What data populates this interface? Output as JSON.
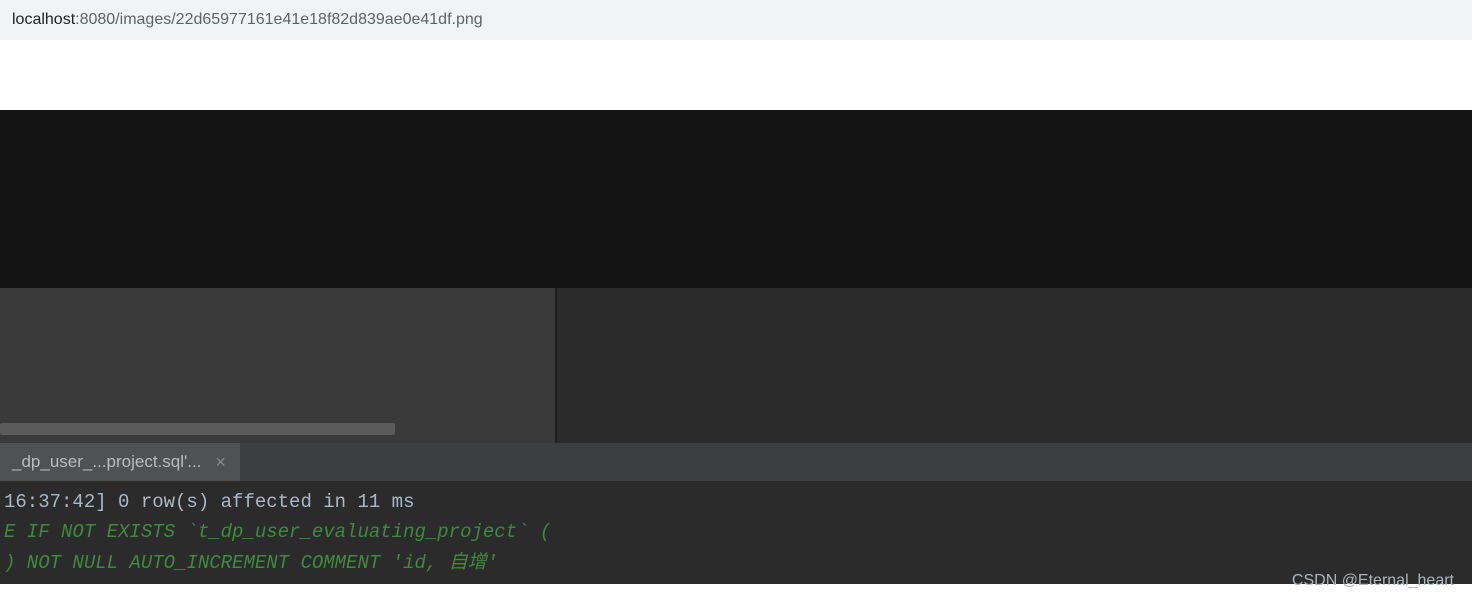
{
  "addressBar": {
    "host": "localhost",
    "path": ":8080/images/22d65977161e41e18f82d839ae0e41df.png"
  },
  "tab": {
    "label": "_dp_user_...project.sql'..."
  },
  "console": {
    "line1": "  16:37:42] 0 row(s) affected in 11 ms",
    "line2": "E IF NOT EXISTS `t_dp_user_evaluating_project` (",
    "line3": ") NOT NULL AUTO_INCREMENT COMMENT 'id, 自增'"
  },
  "watermark": "CSDN @Eternal_heart"
}
